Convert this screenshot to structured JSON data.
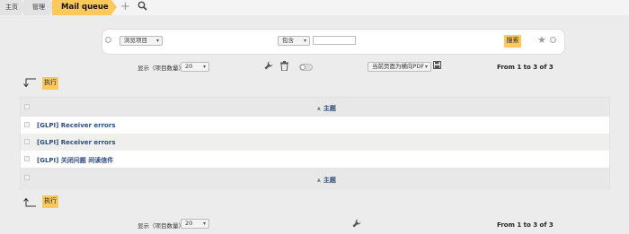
{
  "breadcrumb": {
    "home": "主页",
    "manage": "管理",
    "current": "Mail queue"
  },
  "search": {
    "browse_select": "浏览项目",
    "criteria_select": "包含",
    "value": "",
    "submit": "搜索"
  },
  "toolbar_top": {
    "display_label": "显示（项目数量）",
    "per_page": "20",
    "export_select": "当前页面为横向PDF",
    "pager": "From 1 to 3 of 3"
  },
  "massive_action": "执行",
  "table": {
    "column": "主题",
    "rows": [
      "[GLPI] Receiver errors",
      "[GLPI] Receiver errors",
      "[GLPI] 关闭问题 间读信件"
    ]
  },
  "toolbar_bottom": {
    "display_label": "显示（项目数量）",
    "per_page": "20",
    "pager": "From 1 to 3 of 3"
  },
  "colors": {
    "accent": "#fec95c",
    "link": "#2b4c7e"
  },
  "icons": [
    "plus-icon",
    "search-icon",
    "star-icon",
    "wrench-icon",
    "trash-icon",
    "save-icon",
    "sort-asc-icon",
    "arrow-down-left-icon",
    "arrow-up-left-icon"
  ]
}
